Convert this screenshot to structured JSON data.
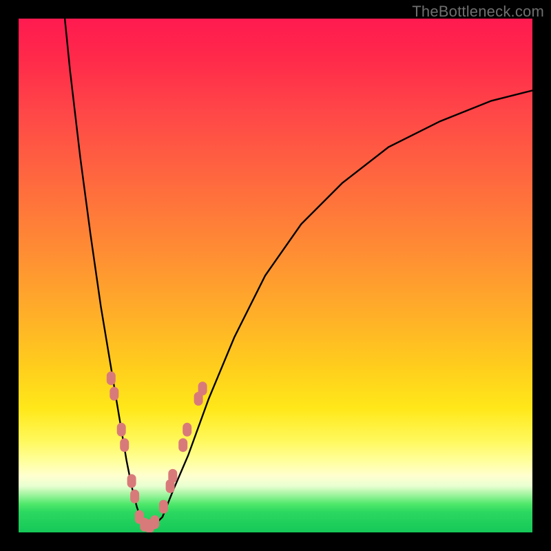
{
  "watermark": "TheBottleneck.com",
  "chart_data": {
    "type": "line",
    "title": "",
    "xlabel": "",
    "ylabel": "",
    "xlim": [
      0,
      100
    ],
    "ylim": [
      0,
      100
    ],
    "series": [
      {
        "name": "curve",
        "x": [
          9,
          10,
          12,
          14,
          16,
          18,
          19,
          20,
          21,
          22,
          23,
          24,
          25,
          26,
          28,
          30,
          33,
          37,
          42,
          48,
          55,
          63,
          72,
          82,
          92,
          100
        ],
        "y": [
          100,
          90,
          73,
          58,
          44,
          32,
          26,
          20,
          14,
          9,
          5,
          2,
          1,
          1,
          3,
          8,
          15,
          26,
          38,
          50,
          60,
          68,
          75,
          80,
          84,
          86
        ]
      }
    ],
    "markers": [
      {
        "cluster": "left",
        "x": 18.0,
        "y": 30
      },
      {
        "cluster": "left",
        "x": 18.6,
        "y": 27
      },
      {
        "cluster": "left",
        "x": 20.0,
        "y": 20
      },
      {
        "cluster": "left",
        "x": 20.6,
        "y": 17
      },
      {
        "cluster": "left",
        "x": 22.0,
        "y": 10
      },
      {
        "cluster": "left",
        "x": 22.6,
        "y": 7
      },
      {
        "cluster": "bottom",
        "x": 23.5,
        "y": 3
      },
      {
        "cluster": "bottom",
        "x": 24.5,
        "y": 1.5
      },
      {
        "cluster": "bottom",
        "x": 25.5,
        "y": 1.2
      },
      {
        "cluster": "bottom",
        "x": 26.5,
        "y": 2
      },
      {
        "cluster": "right",
        "x": 28.2,
        "y": 5
      },
      {
        "cluster": "right",
        "x": 29.5,
        "y": 9
      },
      {
        "cluster": "right",
        "x": 30.0,
        "y": 11
      },
      {
        "cluster": "right",
        "x": 32.0,
        "y": 17
      },
      {
        "cluster": "right",
        "x": 32.8,
        "y": 20
      },
      {
        "cluster": "right",
        "x": 35.0,
        "y": 26
      },
      {
        "cluster": "right",
        "x": 35.8,
        "y": 28
      }
    ],
    "colors": {
      "curve": "#000000",
      "marker_fill": "#d97a7a",
      "gradient_top": "#ff1a50",
      "gradient_mid": "#ffe81a",
      "gradient_bottom": "#15c858"
    }
  }
}
